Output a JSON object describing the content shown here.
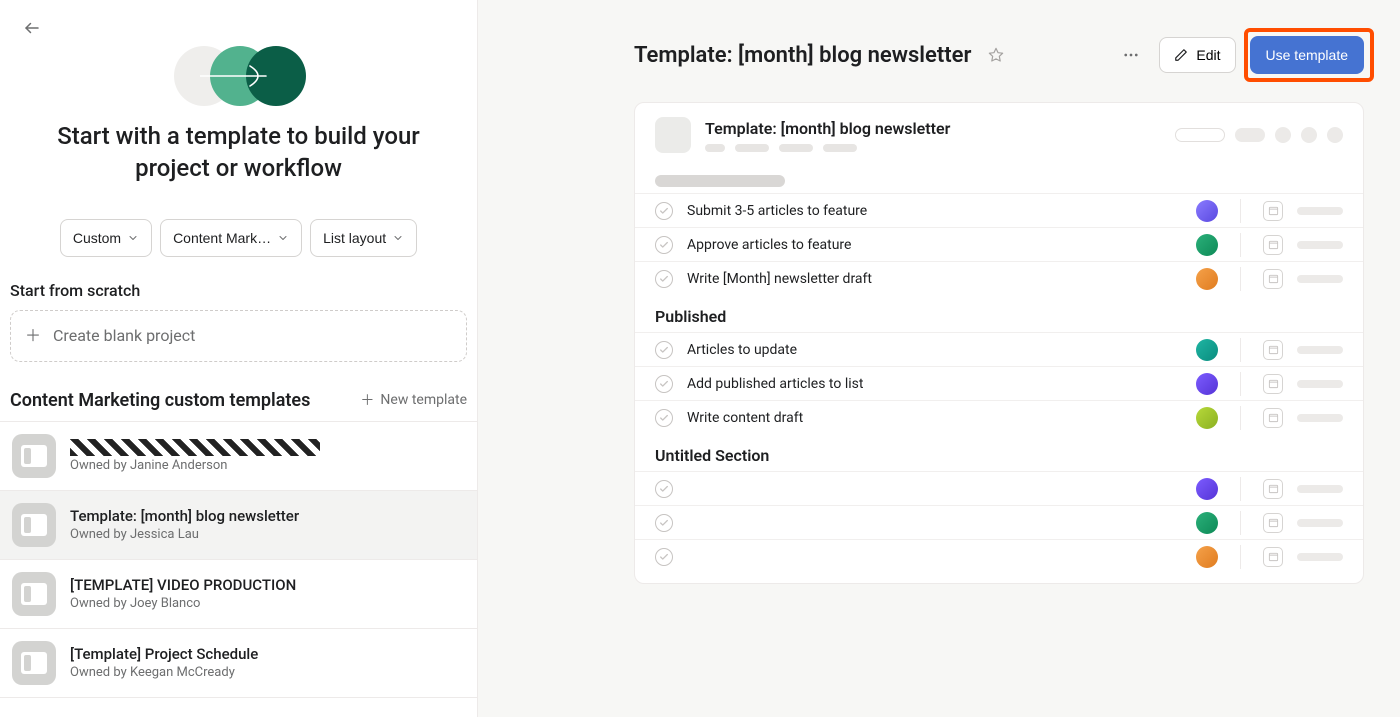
{
  "sidebar": {
    "hero_title": "Start with a template to build your project or workflow",
    "filters": {
      "custom_label": "Custom",
      "team_label": "Content Mark…",
      "layout_label": "List layout"
    },
    "scratch_heading": "Start from scratch",
    "scratch_action": "Create blank project",
    "custom_heading": "Content Marketing custom templates",
    "new_template_label": "New template",
    "templates": [
      {
        "name_redacted": true,
        "owner": "Owned by Janine Anderson"
      },
      {
        "name": "Template: [month] blog newsletter",
        "owner": "Owned by Jessica Lau",
        "selected": true
      },
      {
        "name": "[TEMPLATE] VIDEO PRODUCTION",
        "owner": "Owned by Joey Blanco"
      },
      {
        "name": "[Template] Project Schedule",
        "owner": "Owned by Keegan McCready"
      }
    ]
  },
  "header": {
    "title": "Template: [month] blog newsletter",
    "edit_label": "Edit",
    "use_template_label": "Use template"
  },
  "preview": {
    "title": "Template: [month] blog newsletter",
    "sections": [
      {
        "title_skeleton": true,
        "tasks": [
          {
            "name": "Submit 3-5 articles to feature",
            "avatar": "av1"
          },
          {
            "name": "Approve articles to feature",
            "avatar": "av2"
          },
          {
            "name": "Write [Month] newsletter draft",
            "avatar": "av3"
          }
        ]
      },
      {
        "title": "Published",
        "tasks": [
          {
            "name": "Articles to update",
            "avatar": "av4"
          },
          {
            "name": "Add published articles to list",
            "avatar": "av5"
          },
          {
            "name": "Write content draft",
            "avatar": "av6"
          }
        ]
      },
      {
        "title": "Untitled Section",
        "tasks": [
          {
            "name": "",
            "avatar": "av7"
          },
          {
            "name": "",
            "avatar": "av8"
          },
          {
            "name": "",
            "avatar": "av9"
          }
        ]
      }
    ]
  }
}
